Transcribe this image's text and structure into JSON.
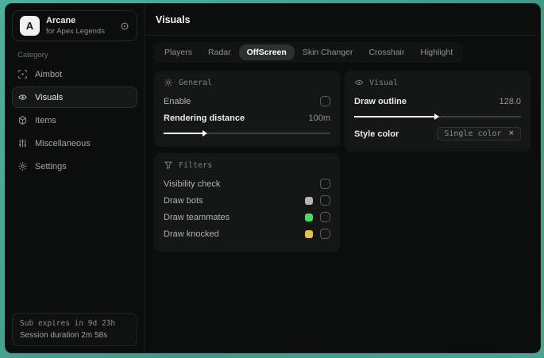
{
  "app": {
    "logo_letter": "A",
    "title": "Arcane",
    "subtitle": "for Apex Legends"
  },
  "sidebar": {
    "category_label": "Category",
    "items": [
      {
        "label": "Aimbot"
      },
      {
        "label": "Visuals"
      },
      {
        "label": "Items"
      },
      {
        "label": "Miscellaneous"
      },
      {
        "label": "Settings"
      }
    ],
    "selected_item": "Visuals",
    "status": {
      "line1": "Sub expires in 9d 23h",
      "line2": "Session duration 2m 58s"
    }
  },
  "main": {
    "title": "Visuals",
    "tabs": [
      {
        "label": "Players"
      },
      {
        "label": "Radar"
      },
      {
        "label": "OffScreen"
      },
      {
        "label": "Skin Changer"
      },
      {
        "label": "Crosshair"
      },
      {
        "label": "Highlight"
      }
    ],
    "selected_tab": "OffScreen",
    "general": {
      "header": "General",
      "enable_label": "Enable",
      "enable_checked": false,
      "rendering_label": "Rendering distance",
      "rendering_value": "100m",
      "rendering_fill": "25%"
    },
    "filters": {
      "header": "Filters",
      "rows": [
        {
          "label": "Visibility check",
          "checked": false
        },
        {
          "label": "Draw bots",
          "swatch": "#b3b6b3",
          "checked": false
        },
        {
          "label": "Draw teammates",
          "swatch": "#4cd964",
          "checked": false
        },
        {
          "label": "Draw knocked",
          "swatch": "#e3c24d",
          "checked": false
        }
      ]
    },
    "visual": {
      "header": "Visual",
      "outline_label": "Draw outline",
      "outline_value": "128.0",
      "outline_fill": "50%",
      "style_label": "Style color",
      "style_tag": "Single color",
      "close_glyph": "×"
    }
  },
  "colors": {
    "desktop_teal": "#45a18c",
    "swatch_gray": "#b3b6b3",
    "swatch_green": "#4cd964",
    "swatch_yellow": "#e3c24d"
  }
}
